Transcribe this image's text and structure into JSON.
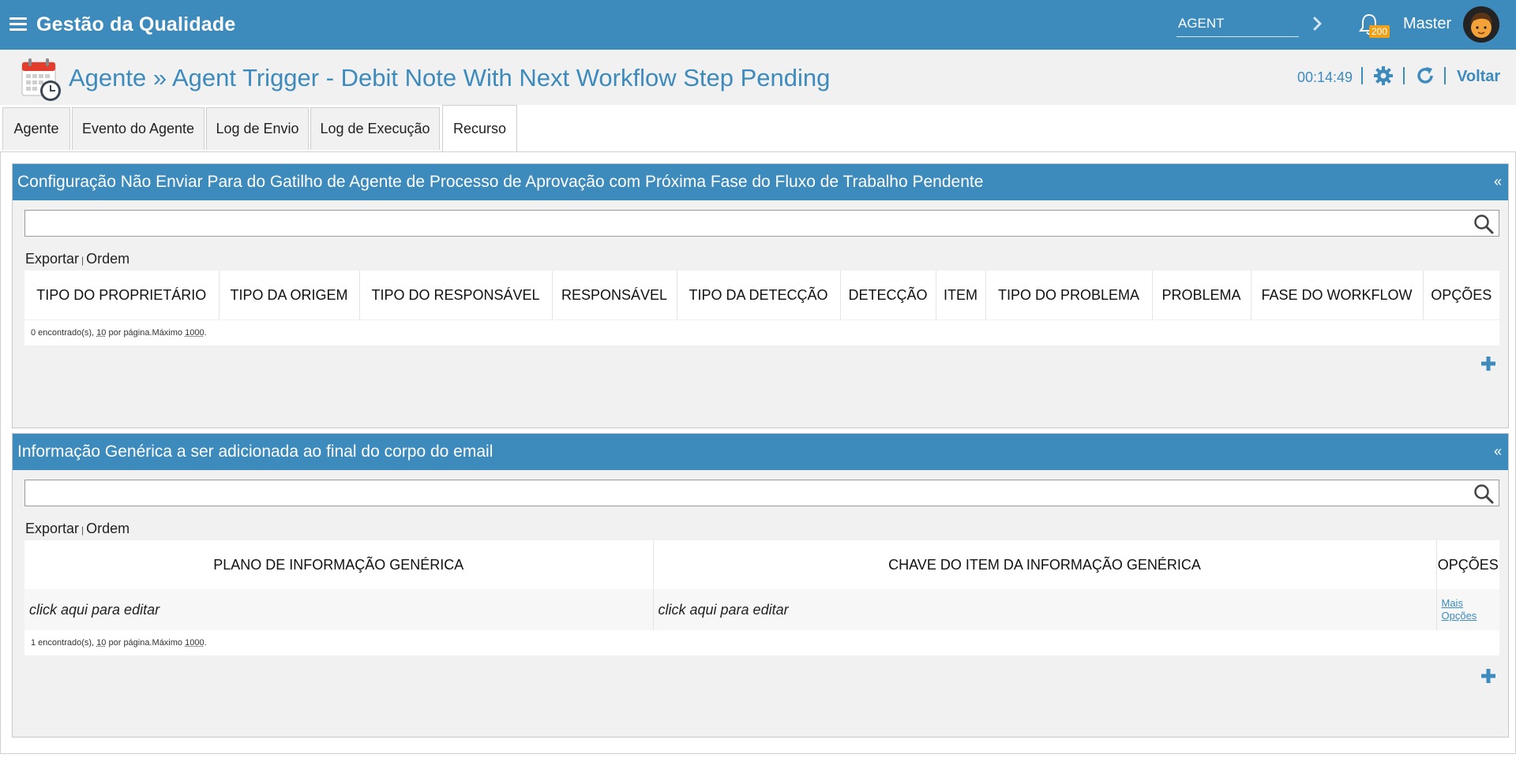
{
  "app": {
    "title": "Gestão da Qualidade"
  },
  "topbar": {
    "search_value": "AGENT",
    "notification_count": "200",
    "user_name": "Master"
  },
  "header": {
    "title": "Agente » Agent Trigger - Debit Note With Next Workflow Step Pending",
    "clock": "00:14:49",
    "back_label": "Voltar"
  },
  "tabs": [
    {
      "label": "Agente"
    },
    {
      "label": "Evento do Agente"
    },
    {
      "label": "Log de Envio"
    },
    {
      "label": "Log de Execução"
    },
    {
      "label": "Recurso"
    }
  ],
  "panel1": {
    "title": "Configuração Não Enviar Para do Gatilho de Agente de Processo de Aprovação com Próxima Fase do Fluxo de Trabalho Pendente",
    "collapse": "«",
    "export": "Exportar",
    "pipe": "|",
    "order": "Ordem",
    "columns": [
      "TIPO DO PROPRIETÁRIO",
      "TIPO DA ORIGEM",
      "TIPO DO RESPONSÁVEL",
      "RESPONSÁVEL",
      "TIPO DA DETECÇÃO",
      "DETECÇÃO",
      "ITEM",
      "TIPO DO PROBLEMA",
      "PROBLEMA",
      "FASE DO WORKFLOW",
      "OPÇÕES"
    ],
    "pager": {
      "found": "0 encontrado(s),",
      "per_page": "10",
      "per_page_suffix": "por página.Máximo",
      "max": "1000",
      "end": "."
    }
  },
  "panel2": {
    "title": "Informação Genérica a ser adicionada ao final do corpo do email",
    "collapse": "«",
    "export": "Exportar",
    "pipe": "|",
    "order": "Ordem",
    "columns": [
      "PLANO DE INFORMAÇÃO GENÉRICA",
      "CHAVE DO ITEM DA INFORMAÇÃO GENÉRICA",
      "OPÇÕES"
    ],
    "rows": [
      {
        "plano": "click aqui para editar",
        "chave": "click aqui para editar",
        "mais_1": "Mais",
        "mais_2": "Opções"
      }
    ],
    "pager": {
      "found": "1 encontrado(s),",
      "per_page": "10",
      "per_page_suffix": "por página.Máximo",
      "max": "1000",
      "end": "."
    }
  },
  "colors": {
    "brand": "#3d8bbd",
    "badge": "#f0a11a",
    "panel_bg": "#f1f1f1"
  },
  "icons": [
    "menu-icon",
    "chevron-right-icon",
    "bell-icon",
    "avatar",
    "calendar-clock-icon",
    "gear-icon",
    "refresh-icon",
    "search-icon",
    "plus-icon"
  ]
}
